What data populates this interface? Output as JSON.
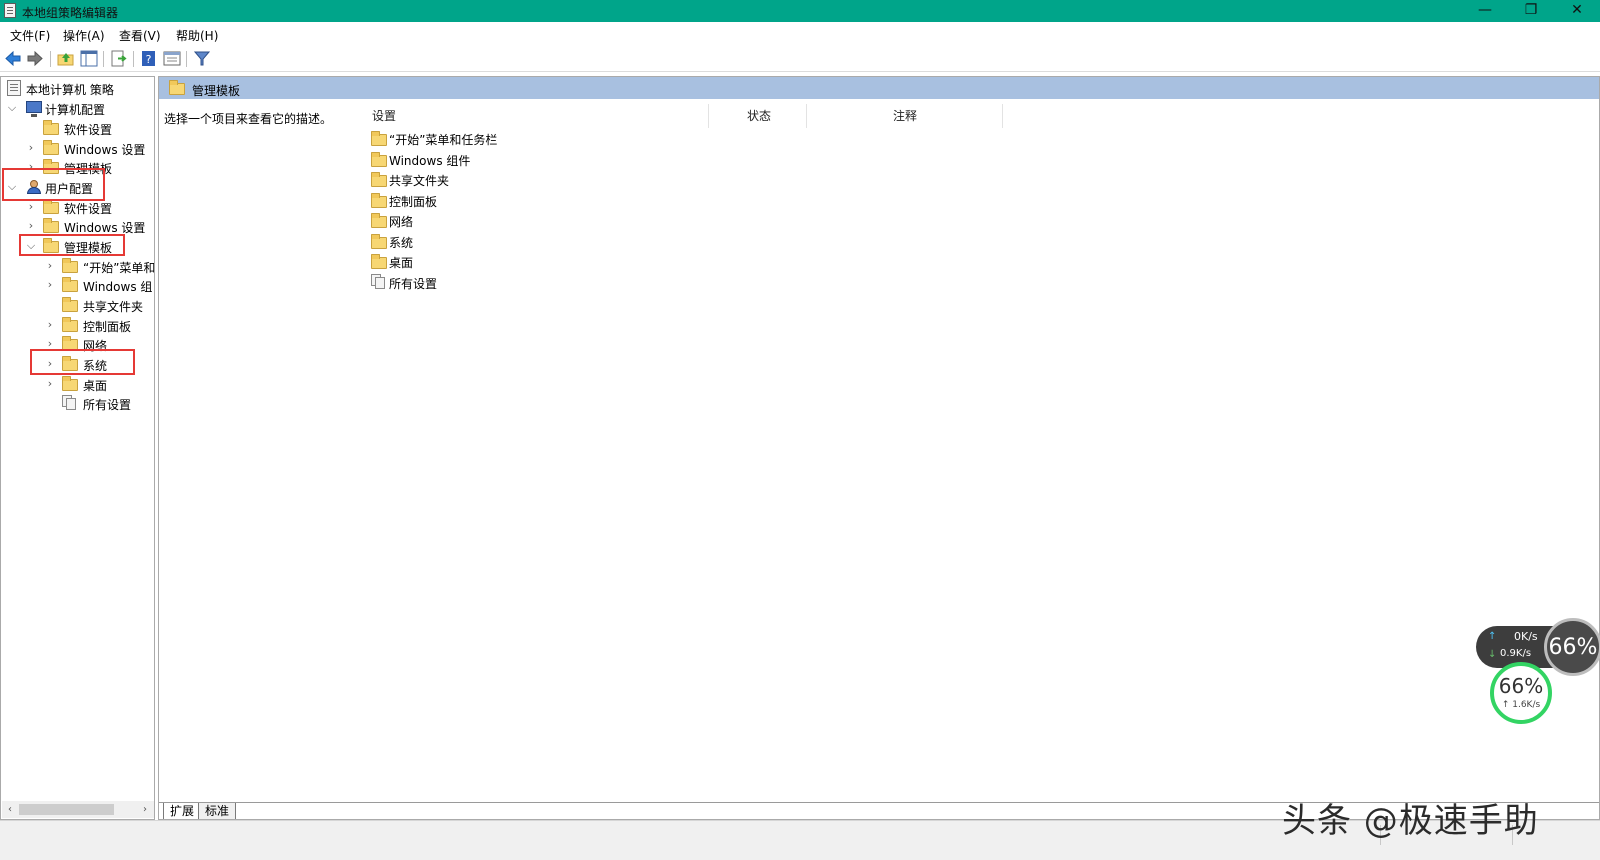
{
  "window": {
    "title": "本地组策略编辑器",
    "min_glyph": "—",
    "restore_glyph": "❐",
    "close_glyph": "✕"
  },
  "menu": [
    "文件(F)",
    "操作(A)",
    "查看(V)",
    "帮助(H)"
  ],
  "toolbar": {
    "buttons": [
      "back-icon",
      "forward-icon",
      "up-folder-icon",
      "show-hide-tree-icon",
      "export-list-icon",
      "help-icon",
      "properties-icon",
      "filter-icon"
    ]
  },
  "tree": {
    "root": "本地计算机 策略",
    "computer_config": "计算机配置",
    "computer_children": [
      "软件设置",
      "Windows 设置",
      "管理模板"
    ],
    "user_config": "用户配置",
    "user_children": [
      "软件设置",
      "Windows 设置",
      "管理模板"
    ],
    "admin_templates_children": [
      "“开始”菜单和",
      "Windows 组",
      "共享文件夹",
      "控制面板",
      "网络",
      "系统",
      "桌面",
      "所有设置"
    ]
  },
  "right": {
    "header_title": "管理模板",
    "description": "选择一个项目来查看它的描述。",
    "columns": [
      "设置",
      "状态",
      "注释"
    ],
    "rows": [
      "“开始”菜单和任务栏",
      "Windows 组件",
      "共享文件夹",
      "控制面板",
      "网络",
      "系统",
      "桌面",
      "所有设置"
    ]
  },
  "tabs": [
    "扩展",
    "标准"
  ],
  "widgets": {
    "net_up_value": "0K/s",
    "net_down_value": "0.9K/s",
    "ring_percent": "66%",
    "green_percent": "66%",
    "green_speed": "↑ 1.6K/s"
  },
  "watermark": "头条 @极速手助",
  "colors": {
    "titlebar": "#00a58a",
    "header_band": "#a8c0e0",
    "highlight": "#e53935",
    "folder": "#f7d774"
  }
}
